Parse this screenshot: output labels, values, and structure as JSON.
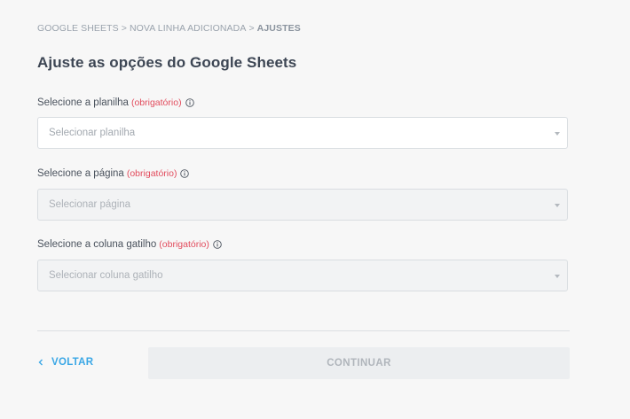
{
  "breadcrumb": {
    "items": [
      "GOOGLE SHEETS",
      "NOVA LINHA ADICIONADA",
      "AJUSTES"
    ],
    "separator": ">"
  },
  "title": "Ajuste as opções do Google Sheets",
  "fields": [
    {
      "label": "Selecione a planilha",
      "required_text": "(obrigatório)",
      "placeholder": "Selecionar planilha",
      "enabled": true
    },
    {
      "label": "Selecione a página",
      "required_text": "(obrigatório)",
      "placeholder": "Selecionar página",
      "enabled": false
    },
    {
      "label": "Selecione a coluna gatilho",
      "required_text": "(obrigatório)",
      "placeholder": "Selecionar coluna gatilho",
      "enabled": false
    }
  ],
  "footer": {
    "back_label": "VOLTAR",
    "continue_label": "CONTINUAR"
  },
  "colors": {
    "accent": "#3aa7e6",
    "required": "#e24c5d",
    "background": "#f7f7f7"
  },
  "icons": [
    "info-icon",
    "chevron-down-icon",
    "chevron-left-icon"
  ]
}
